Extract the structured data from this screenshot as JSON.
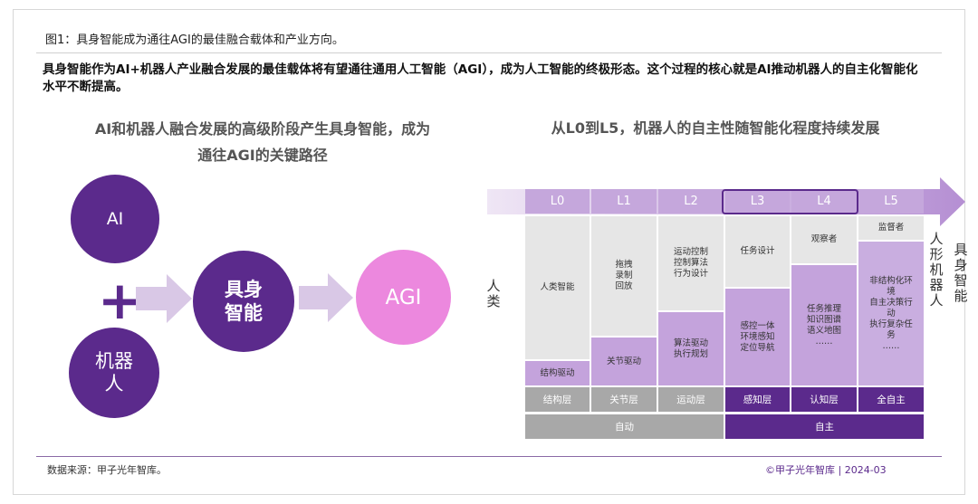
{
  "figure_title": "图1：具身智能成为通往AGI的最佳融合载体和产业方向。",
  "summary": "具身智能作为AI+机器人产业融合发展的最佳载体将有望通往通用人工智能（AGI），成为人工智能的终极形态。这个过程的核心就是AI推动机器人的自主化智能化水平不断提高。",
  "left_panel": {
    "subtitle_line1": "AI和机器人融合发展的高级阶段产生具身智能，成为",
    "subtitle_line2": "通往AGI的关键路径",
    "ai_label": "AI",
    "plus_sign": "+",
    "robot_line1": "机器",
    "robot_line2": "人",
    "embodied_line1": "具身",
    "embodied_line2": "智能",
    "agi_label": "AGI",
    "colors": {
      "dark_purple": "#5b2a8c",
      "pink": "#ec88de",
      "arrow": "#d9c8e6"
    }
  },
  "right_panel": {
    "subtitle": "从L0到L5，机器人的自主性随智能化程度持续发展",
    "levels": [
      "L0",
      "L1",
      "L2",
      "L3",
      "L4",
      "L5"
    ],
    "highlighted_levels": [
      "L3",
      "L4"
    ],
    "left_axis_label": "人类",
    "middle_axis_label": "人形机器人",
    "right_axis_label": "具身智能",
    "l0_gray": "人类智能",
    "l0_purple": "结构驱动",
    "l1_gray_line1": "拖拽",
    "l1_gray_line2": "录制",
    "l1_gray_line3": "回放",
    "l1_purple": "关节驱动",
    "l2_gray_line1": "运动控制",
    "l2_gray_line2": "控制算法",
    "l2_gray_line3": "行为设计",
    "l2_purple_line1": "算法驱动",
    "l2_purple_line2": "执行规划",
    "l3_gray": "任务设计",
    "l3_purple_line1": "感控一体",
    "l3_purple_line2": "环境感知",
    "l3_purple_line3": "定位导航",
    "l4_gray": "观察者",
    "l4_purple_line1": "任务推理",
    "l4_purple_line2": "知识图谱",
    "l4_purple_line3": "语义地图",
    "l4_purple_line4": "……",
    "l5_gray": "监督者",
    "l5_purple_line1": "非结构化环",
    "l5_purple_line2": "境",
    "l5_purple_line3": "自主决策行",
    "l5_purple_line4": "动",
    "l5_purple_line5": "执行复杂任",
    "l5_purple_line6": "务",
    "l5_purple_line7": "……",
    "layers": [
      "结构层",
      "关节层",
      "运动层",
      "感知层",
      "认知层",
      "全自主"
    ],
    "mode_auto": "自动",
    "mode_autonomous": "自主"
  },
  "footer": {
    "source": "数据来源：甲子光年智库。",
    "copyright": "©甲子光年智库 | 2024-03"
  }
}
